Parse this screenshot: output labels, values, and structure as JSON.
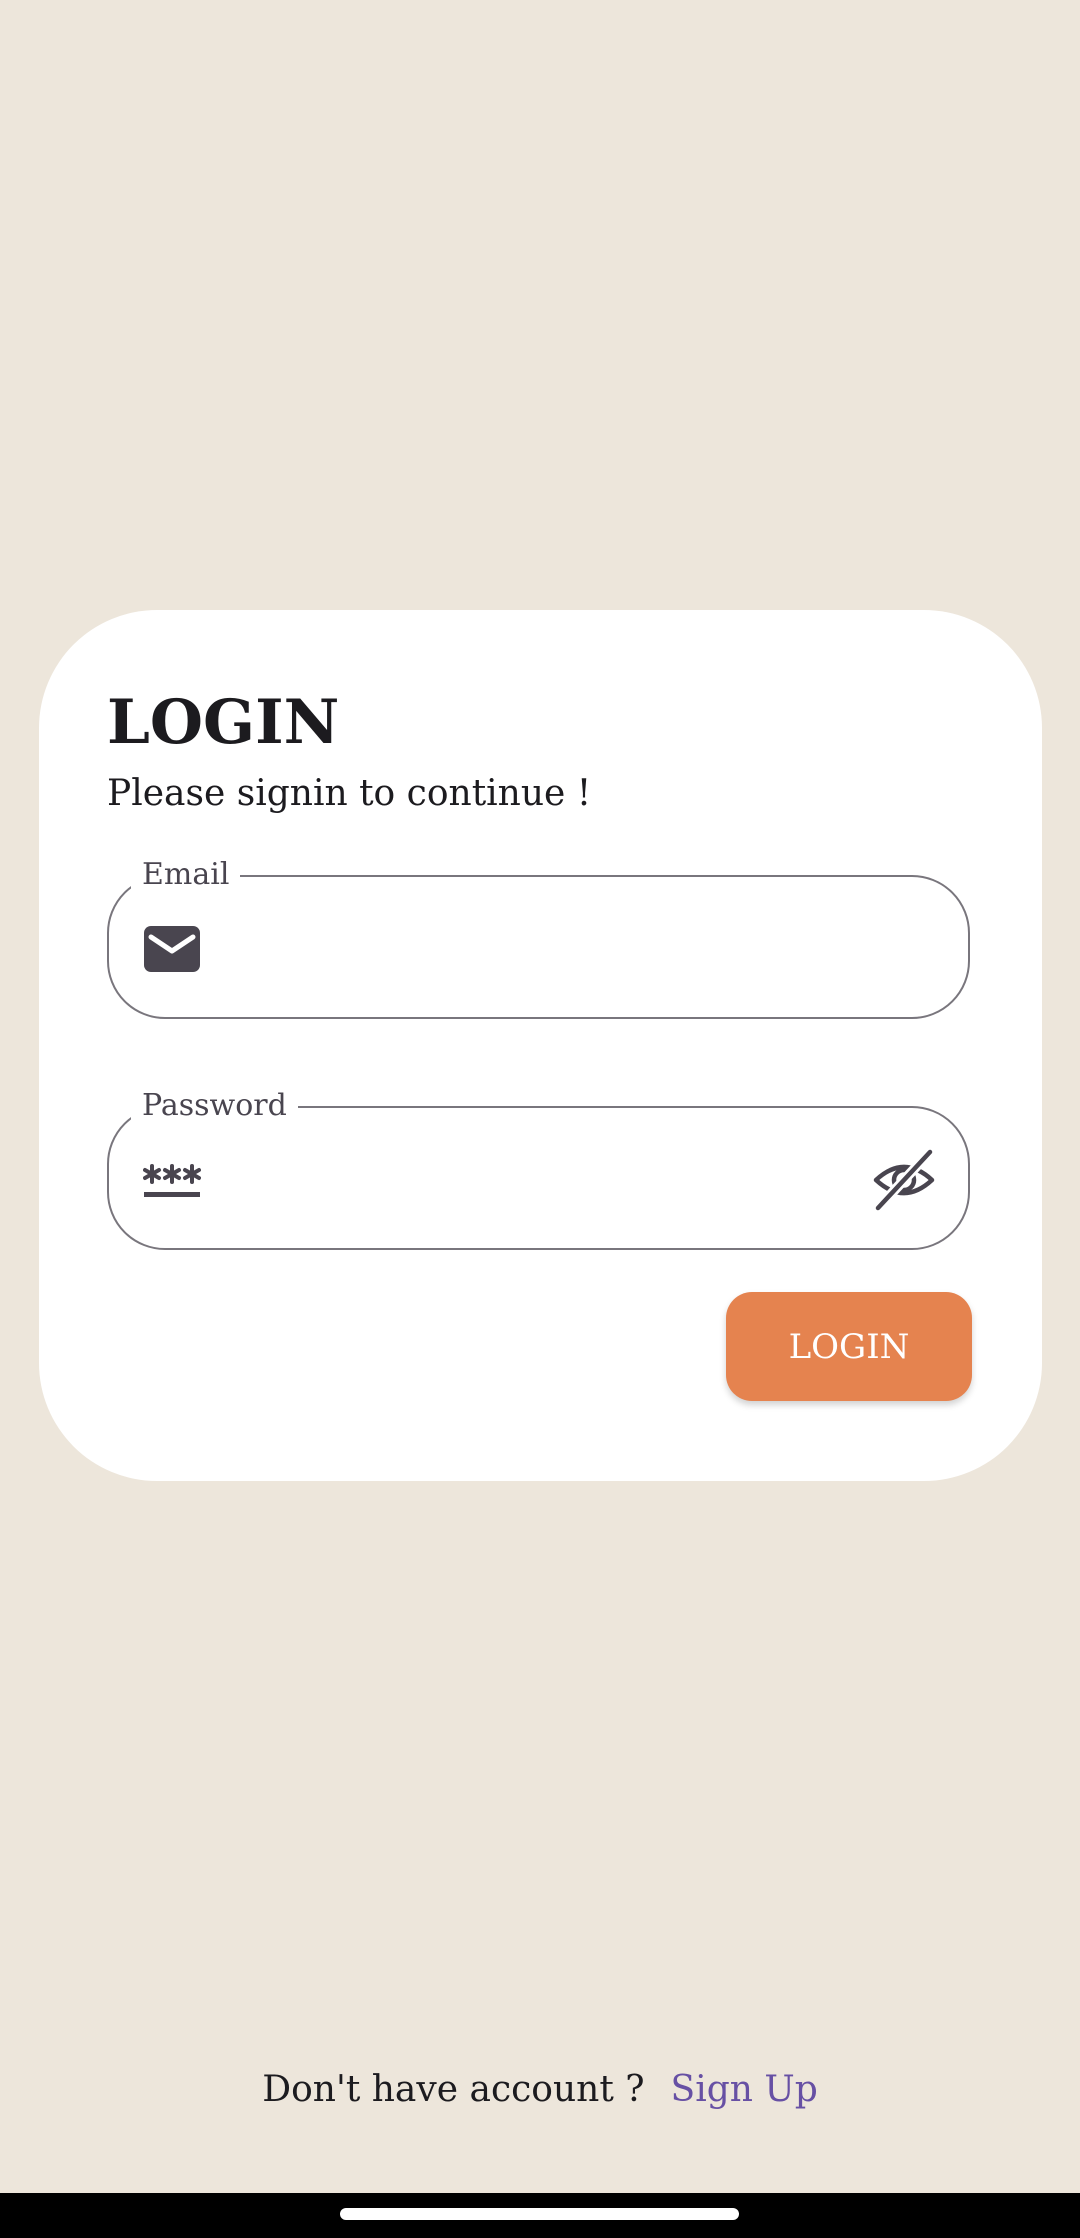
{
  "login": {
    "title": "LOGIN",
    "subtitle": "Please signin to continue !",
    "email_label": "Email",
    "email_value": "",
    "password_label": "Password",
    "password_value": "",
    "button_label": "LOGIN"
  },
  "footer": {
    "prompt": "Don't have account ?",
    "signup_label": "Sign Up"
  },
  "icons": {
    "email": "mail-icon",
    "password": "password-icon",
    "visibility": "eye-off-icon"
  },
  "colors": {
    "background": "#EDE6DB",
    "card": "#FFFFFF",
    "accent": "#E5834F",
    "link": "#6750A4",
    "outline": "#79767D"
  }
}
